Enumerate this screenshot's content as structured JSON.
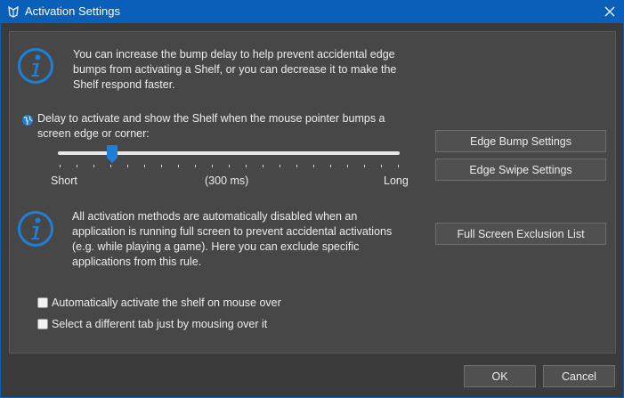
{
  "window": {
    "title": "Activation Settings"
  },
  "info1": {
    "text_line1": "You can increase the bump delay to help prevent accidental edge",
    "text_line2": "bumps from activating a Shelf, or you can decrease it to make the",
    "text_line3": "Shelf respond faster."
  },
  "delay": {
    "label_line1": "Delay to activate and show the Shelf when the mouse pointer bumps a",
    "label_line2": "screen edge or corner:",
    "min_label": "Short",
    "max_label": "Long",
    "value_label": "(300 ms)",
    "value_fraction": 0.16
  },
  "buttons": {
    "edge_bump": "Edge Bump Settings",
    "edge_swipe": "Edge Swipe Settings",
    "full_screen": "Full Screen Exclusion List",
    "ok": "OK",
    "cancel": "Cancel"
  },
  "info2": {
    "text_line1": "All activation methods are automatically disabled when an",
    "text_line2": "application is running full screen to prevent accidental activations",
    "text_line3": "(e.g. while playing a game). Here you can exclude specific",
    "text_line4": "applications from this rule."
  },
  "options": [
    {
      "label": "Automatically activate the shelf on mouse over",
      "checked": false
    },
    {
      "label": "Select a different tab just by mousing over it",
      "checked": false
    }
  ],
  "colors": {
    "accent": "#0a5fb8",
    "info_blue": "#1e7fd8"
  }
}
